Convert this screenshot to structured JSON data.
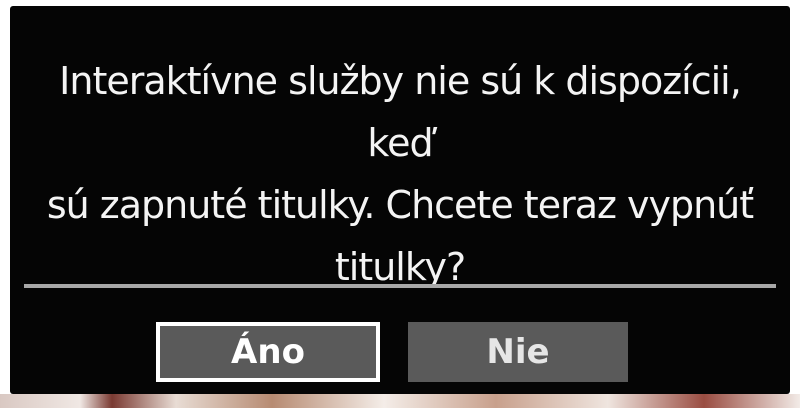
{
  "dialog": {
    "message_lines": [
      "Interaktívne služby nie sú k dispozícii, keď",
      "sú zapnuté titulky. Chcete teraz vypnúť",
      "titulky?"
    ],
    "buttons": {
      "yes_label": "Áno",
      "no_label": "Nie"
    },
    "selected_button": "yes"
  },
  "colors": {
    "dialog_background": "#050505",
    "text": "#f4f4f4",
    "divider": "#a8a8a8",
    "button_background": "#5a5a5a",
    "focus_border": "#ffffff"
  }
}
